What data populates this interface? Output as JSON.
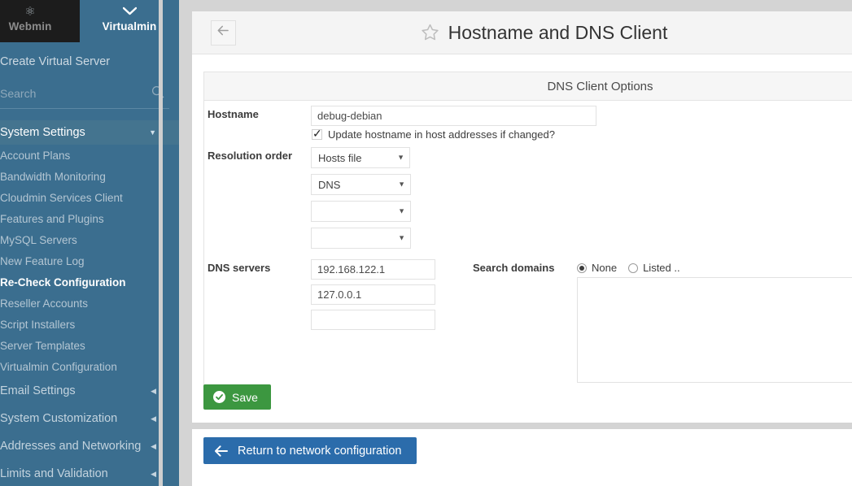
{
  "sidebar": {
    "tabs": [
      {
        "label": "Webmin",
        "icon": "webmin-logo-icon",
        "active": false
      },
      {
        "label": "Virtualmin",
        "icon": "chevron-down-icon",
        "active": true
      }
    ],
    "create_virtual_server": "Create Virtual Server",
    "search": {
      "placeholder": "Search",
      "value": "",
      "icon": "search-icon"
    },
    "section": {
      "label": "System Settings",
      "icon": "chevron-down-icon"
    },
    "items": [
      {
        "label": "Account Plans",
        "active": false,
        "group": false
      },
      {
        "label": "Bandwidth Monitoring",
        "active": false,
        "group": false
      },
      {
        "label": "Cloudmin Services Client",
        "active": false,
        "group": false
      },
      {
        "label": "Features and Plugins",
        "active": false,
        "group": false
      },
      {
        "label": "MySQL Servers",
        "active": false,
        "group": false
      },
      {
        "label": "New Feature Log",
        "active": false,
        "group": false
      },
      {
        "label": "Re-Check Configuration",
        "active": true,
        "group": false
      },
      {
        "label": "Reseller Accounts",
        "active": false,
        "group": false
      },
      {
        "label": "Script Installers",
        "active": false,
        "group": false
      },
      {
        "label": "Server Templates",
        "active": false,
        "group": false
      },
      {
        "label": "Virtualmin Configuration",
        "active": false,
        "group": false
      },
      {
        "label": "Email Settings",
        "active": false,
        "group": true
      },
      {
        "label": "System Customization",
        "active": false,
        "group": true
      },
      {
        "label": "Addresses and Networking",
        "active": false,
        "group": true
      },
      {
        "label": "Limits and Validation",
        "active": false,
        "group": true
      }
    ]
  },
  "header": {
    "back_icon": "arrow-left-icon",
    "favorite_icon": "star-icon",
    "title": "Hostname and DNS Client"
  },
  "form": {
    "section_title": "DNS Client Options",
    "hostname": {
      "label": "Hostname",
      "value": "debug-debian",
      "placeholder": ""
    },
    "update_hostname": {
      "label": "Update hostname in host addresses if changed?",
      "checked": true
    },
    "resolution_order": {
      "label": "Resolution order",
      "selects": [
        {
          "value": "Hosts file"
        },
        {
          "value": "DNS"
        },
        {
          "value": ""
        },
        {
          "value": ""
        }
      ]
    },
    "dns_servers": {
      "label": "DNS servers",
      "values": [
        "192.168.122.1",
        "127.0.0.1",
        ""
      ]
    },
    "search_domains": {
      "label": "Search domains",
      "options": [
        {
          "label": "None",
          "selected": true
        },
        {
          "label": "Listed ..",
          "selected": false
        }
      ],
      "textarea_value": ""
    },
    "save": {
      "label": "Save",
      "icon": "check-circle-icon"
    }
  },
  "footer": {
    "return": {
      "label": "Return to network configuration",
      "icon": "arrow-left-icon"
    }
  },
  "colors": {
    "sidebar_bg": "#3b6e8f",
    "sidebar_section_bg": "#44748f",
    "webmin_tab_bg": "#1c1c1c",
    "save_green": "#3c9740",
    "return_blue": "#2b6cab",
    "page_bg": "#d4d4d4"
  }
}
